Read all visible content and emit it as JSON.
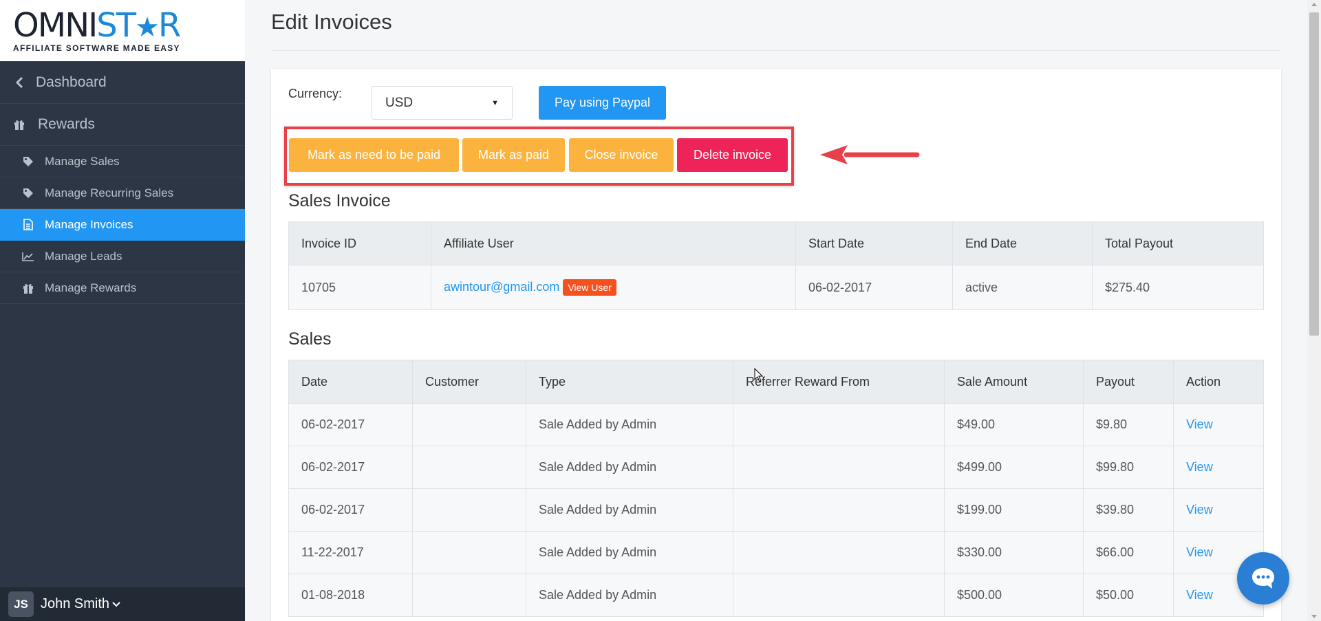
{
  "brand": {
    "logo_part1": "OMNI",
    "logo_part2": "ST",
    "logo_part3": "R",
    "tagline": "AFFILIATE SOFTWARE MADE EASY"
  },
  "sidebar": {
    "dashboard_label": "Dashboard",
    "rewards_label": "Rewards",
    "items": [
      {
        "label": "Manage Sales",
        "icon": "tag-icon"
      },
      {
        "label": "Manage Recurring Sales",
        "icon": "tag-icon"
      },
      {
        "label": "Manage Invoices",
        "icon": "file-icon",
        "active": true
      },
      {
        "label": "Manage Leads",
        "icon": "chart-line-icon"
      },
      {
        "label": "Manage Rewards",
        "icon": "gift-icon"
      }
    ]
  },
  "user": {
    "initials": "JS",
    "name": "John Smith"
  },
  "page": {
    "title": "Edit Invoices"
  },
  "currency": {
    "label": "Currency:",
    "selected": "USD"
  },
  "buttons": {
    "pay_paypal": "Pay using Paypal",
    "mark_need_paid": "Mark as need to be paid",
    "mark_paid": "Mark as paid",
    "close_invoice": "Close invoice",
    "delete_invoice": "Delete invoice"
  },
  "invoice": {
    "section_title": "Sales Invoice",
    "columns": [
      "Invoice ID",
      "Affiliate User",
      "Start Date",
      "End Date",
      "Total Payout"
    ],
    "row": {
      "invoice_id": "10705",
      "affiliate_email": "awintour@gmail.com",
      "view_user_label": "View User",
      "start_date": "06-02-2017",
      "end_date": "active",
      "total_payout": "$275.40"
    }
  },
  "sales": {
    "section_title": "Sales",
    "columns": [
      "Date",
      "Customer",
      "Type",
      "Referrer Reward From",
      "Sale Amount",
      "Payout",
      "Action"
    ],
    "rows": [
      {
        "date": "06-02-2017",
        "customer": "",
        "type": "Sale Added by Admin",
        "referrer": "",
        "amount": "$49.00",
        "payout": "$9.80",
        "action": "View"
      },
      {
        "date": "06-02-2017",
        "customer": "",
        "type": "Sale Added by Admin",
        "referrer": "",
        "amount": "$499.00",
        "payout": "$99.80",
        "action": "View"
      },
      {
        "date": "06-02-2017",
        "customer": "",
        "type": "Sale Added by Admin",
        "referrer": "",
        "amount": "$199.00",
        "payout": "$39.80",
        "action": "View"
      },
      {
        "date": "11-22-2017",
        "customer": "",
        "type": "Sale Added by Admin",
        "referrer": "",
        "amount": "$330.00",
        "payout": "$66.00",
        "action": "View"
      },
      {
        "date": "01-08-2018",
        "customer": "",
        "type": "Sale Added by Admin",
        "referrer": "",
        "amount": "$500.00",
        "payout": "$50.00",
        "action": "View"
      }
    ]
  },
  "colors": {
    "sidebar_bg": "#2c3644",
    "accent_blue": "#2196f3",
    "warning_orange": "#fbb33e",
    "danger_pink": "#ee2459",
    "highlight_red": "#e8404b"
  }
}
